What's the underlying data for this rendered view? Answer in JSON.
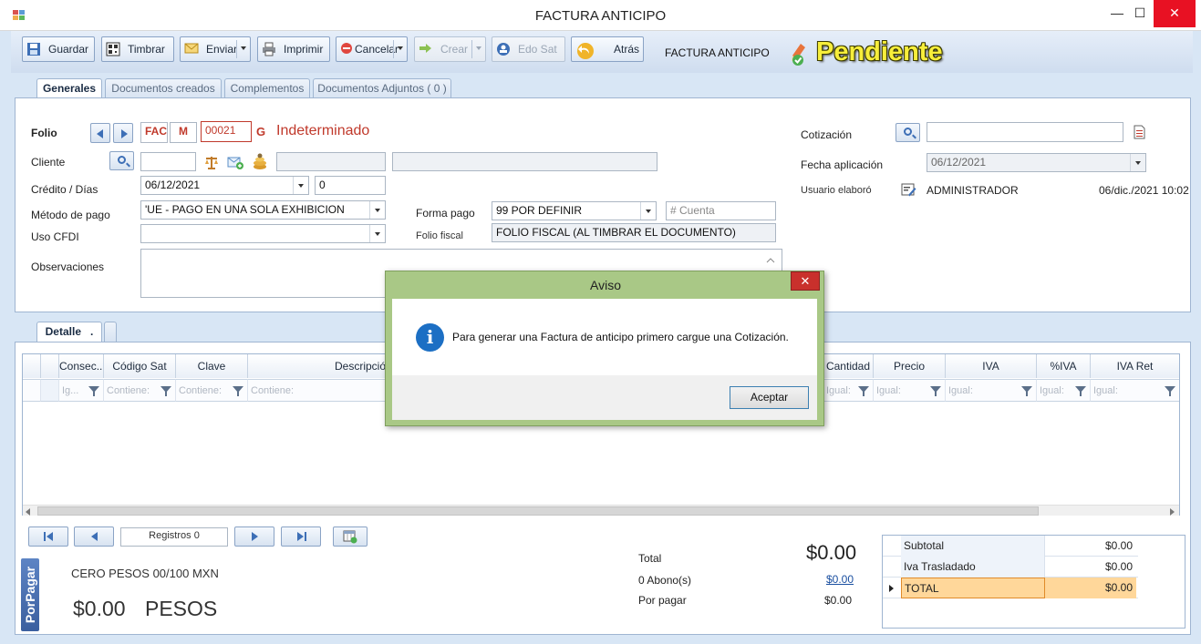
{
  "window": {
    "title": "FACTURA ANTICIPO",
    "minimize": "—",
    "maximize": "☐",
    "close": "✕"
  },
  "toolbar": {
    "guardar": "Guardar",
    "timbrar": "Timbrar",
    "enviar": "Enviar",
    "imprimir": "Imprimir",
    "cancelar": "Cancelar",
    "crear": "Crear",
    "edo_sat": "Edo Sat",
    "atras": "Atrás",
    "doc_type": "FACTURA ANTICIPO",
    "status": "Pendiente"
  },
  "tabs": [
    "Generales",
    "Documentos creados",
    "Complementos",
    "Documentos Adjuntos ( 0 )"
  ],
  "form": {
    "folio_label": "Folio",
    "serie_fac": "FAC",
    "serie_m": "M",
    "folio_number": "00021",
    "folio_suffix": "G",
    "folio_status": "Indeterminado",
    "cliente_label": "Cliente",
    "credito_label": "Crédito / Días",
    "credito_date": "06/12/2021",
    "credito_days": "0",
    "metodo_label": "Método de pago",
    "metodo_value": "'UE - PAGO EN UNA SOLA EXHIBICION",
    "uso_label": "Uso CFDI",
    "uso_value": "",
    "obs_label": "Observaciones",
    "forma_label": "Forma pago",
    "forma_value": "99 POR DEFINIR",
    "cuenta_placeholder": "# Cuenta",
    "folio_fiscal_label": "Folio fiscal",
    "folio_fiscal_value": "FOLIO FISCAL (AL TIMBRAR EL DOCUMENTO)",
    "cotizacion_label": "Cotización",
    "fecha_aplicacion_label": "Fecha aplicación",
    "fecha_aplicacion_value": "06/12/2021",
    "usuario_label": "Usuario elaboró",
    "usuario_value": "ADMINISTRADOR",
    "usuario_date": "06/dic./2021 10:02"
  },
  "detail_tabs": [
    "Detalle",
    "."
  ],
  "grid": {
    "columns": [
      "Consec...",
      "Código Sat",
      "Clave",
      "Descripción",
      "Cantidad",
      "Precio",
      "IVA",
      "%IVA",
      "IVA Ret"
    ],
    "filters": [
      "Ig...",
      "Contiene:",
      "Contiene:",
      "Contiene:",
      "Igual:",
      "Igual:",
      "Igual:",
      "Igual:",
      "Igual:"
    ]
  },
  "pager": {
    "registros": "Registros  0"
  },
  "totals": {
    "porpagar_tag": "PorPagar",
    "amount_words": "CERO PESOS 00/100 MXN",
    "amount_big": "$0.00",
    "currency": "PESOS",
    "total_label": "Total",
    "total_value": "$0.00",
    "abonos_label": "0 Abono(s)",
    "abonos_value": "$0.00",
    "por_pagar_label": "Por pagar",
    "por_pagar_value": "$0.00"
  },
  "summary": [
    {
      "label": "Subtotal",
      "value": "$0.00"
    },
    {
      "label": "Iva Trasladado",
      "value": "$0.00"
    },
    {
      "label": "TOTAL",
      "value": "$0.00"
    }
  ],
  "dialog": {
    "title": "Aviso",
    "close": "✕",
    "icon": "i",
    "message": "Para generar una Factura de anticipo primero cargue una Cotización.",
    "ok": "Aceptar"
  }
}
